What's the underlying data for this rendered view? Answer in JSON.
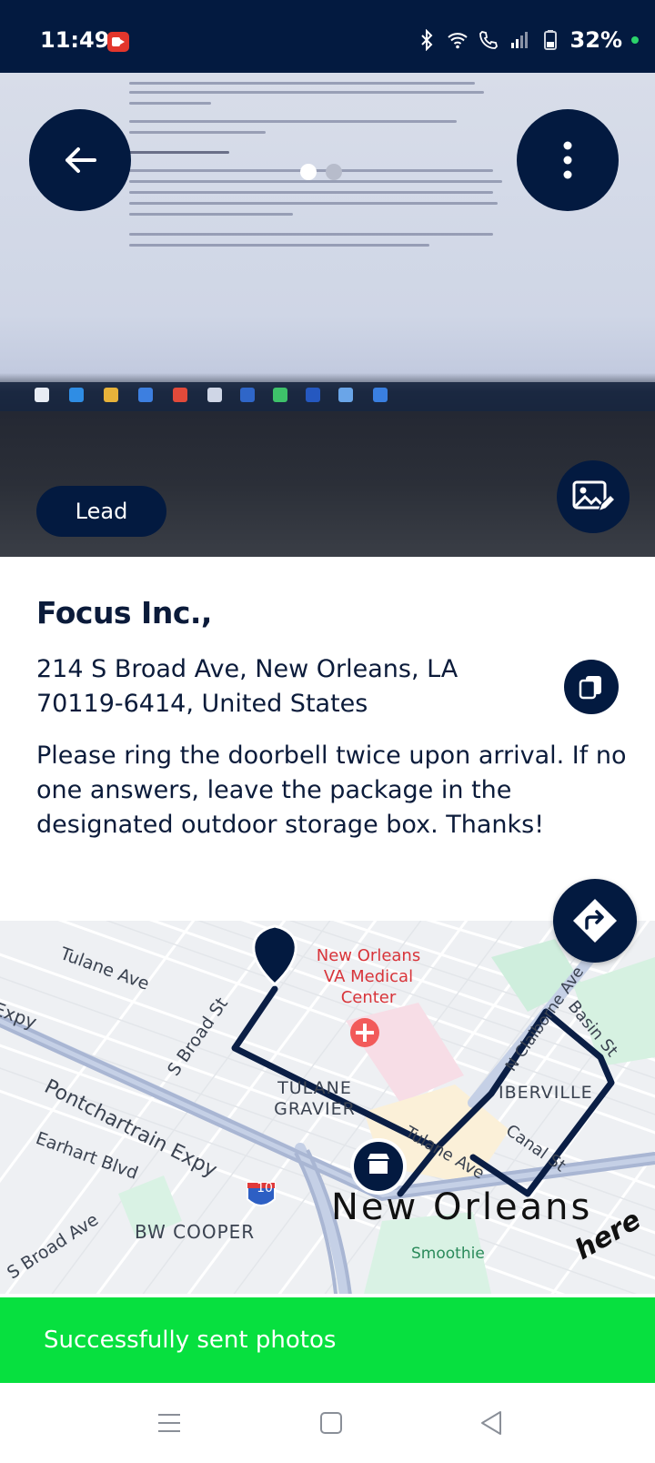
{
  "status_bar": {
    "time": "11:49",
    "battery": "32%",
    "icons": [
      "screen-record-icon",
      "bluetooth-icon",
      "wifi-icon",
      "call-icon",
      "signal-icon",
      "battery-icon"
    ]
  },
  "photo": {
    "badge": "Lead",
    "page_count": 2,
    "current_page": 1
  },
  "lead": {
    "company": "Focus Inc.,",
    "address": "214 S Broad Ave, New Orleans, LA 70119-6414, United States",
    "note": "Please ring the doorbell twice upon arrival. If no one answers, leave the package in the designated outdoor storage box. Thanks!"
  },
  "map": {
    "labels": {
      "tulane_ave_1": "Tulane Ave",
      "expy_fragment": "Expy",
      "pontchartrain": "Pontchartrain Expy",
      "s_broad_st": "S Broad St",
      "earhart": "Earhart Blvd",
      "s_broad_ave": "S Broad Ave",
      "bw_cooper": "BW COOPER",
      "va_center": "New Orleans VA Medical Center",
      "tulane_gravier": "TULANE GRAVIER",
      "iberville": "IBERVILLE",
      "tulane_ave_2": "Tulane Ave",
      "canal": "Canal St",
      "basin": "Basin St",
      "n_claiborne": "N Claiborne Ave",
      "new_orleans": "New Orleans",
      "i10": "10",
      "smoothie": "Smoothie",
      "here_logo": "here"
    }
  },
  "toast": "Successfully sent photos",
  "colors": {
    "primary": "#031a40",
    "toast": "#07e03f",
    "route": "#0a1e45"
  }
}
